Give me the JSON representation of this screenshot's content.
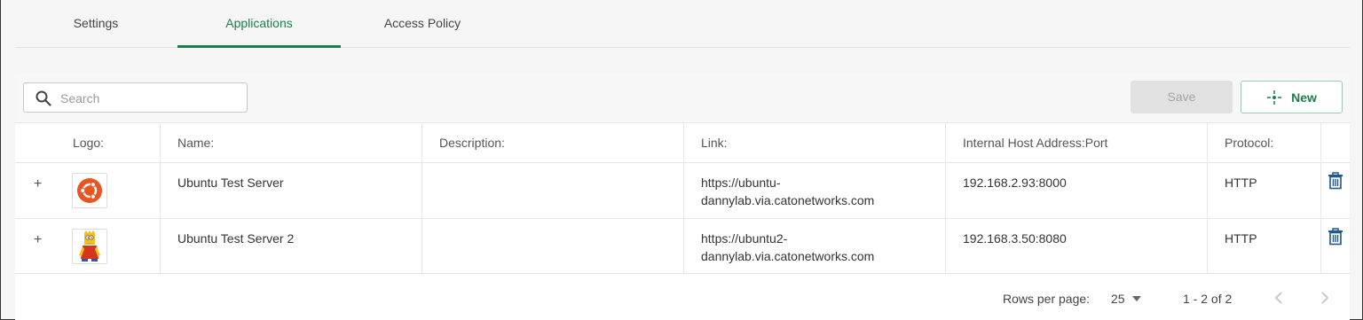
{
  "tabs": [
    {
      "label": "Settings"
    },
    {
      "label": "Applications"
    },
    {
      "label": "Access Policy"
    }
  ],
  "toolbar": {
    "search_placeholder": "Search",
    "save_label": "Save",
    "new_label": "New"
  },
  "table": {
    "headers": {
      "logo": "Logo:",
      "name": "Name:",
      "description": "Description:",
      "link": "Link:",
      "host": "Internal Host Address:Port",
      "protocol": "Protocol:"
    },
    "rows": [
      {
        "expand": "+",
        "logo_icon": "ubuntu-logo-icon",
        "name": "Ubuntu Test Server",
        "description": "",
        "link_line1": "https://ubuntu-",
        "link_line2": "dannylab.via.catonetworks.com",
        "host": "192.168.2.93:8000",
        "protocol": "HTTP"
      },
      {
        "expand": "+",
        "logo_icon": "cartoon-character-icon",
        "name": "Ubuntu Test Server 2",
        "description": "",
        "link_line1": "https://ubuntu2-",
        "link_line2": "dannylab.via.catonetworks.com",
        "host": "192.168.3.50:8080",
        "protocol": "HTTP"
      }
    ]
  },
  "pagination": {
    "rows_per_page_label": "Rows per page:",
    "rows_per_page_value": "25",
    "range": "1 - 2 of 2"
  },
  "colors": {
    "accent": "#1a7f4b",
    "trash": "#1f5a8a"
  }
}
